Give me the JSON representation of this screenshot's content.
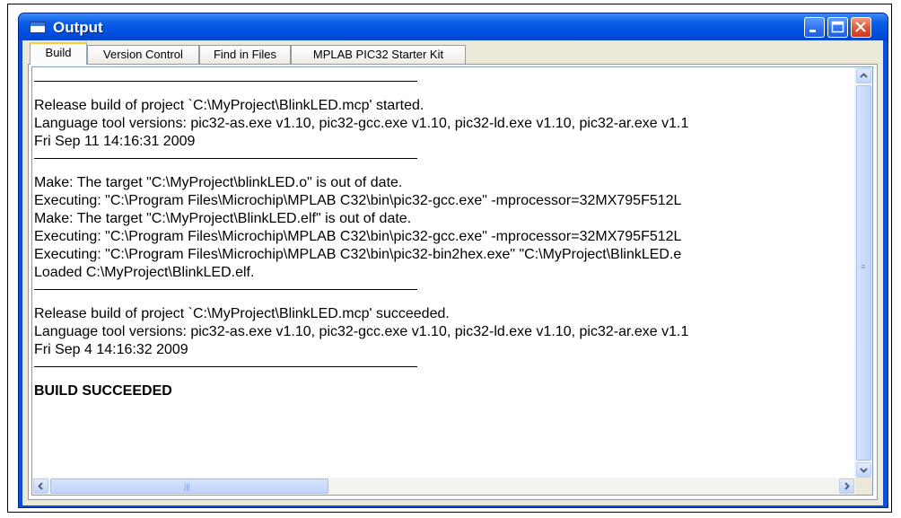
{
  "window": {
    "title": "Output",
    "accent": "#0a5de6",
    "close_color": "#e0563a"
  },
  "tabs": [
    {
      "label": "Build",
      "active": true
    },
    {
      "label": "Version Control",
      "active": false
    },
    {
      "label": "Find in Files",
      "active": false
    },
    {
      "label": "MPLAB PIC32 Starter Kit",
      "active": false
    }
  ],
  "output": {
    "lines": [
      "Release build of project `C:\\MyProject\\BlinkLED.mcp' started.",
      "Language tool versions: pic32-as.exe v1.10, pic32-gcc.exe v1.10, pic32-ld.exe v1.10, pic32-ar.exe v1.1",
      "Fri Sep 11 14:16:31 2009",
      "Make: The target \"C:\\MyProject\\blinkLED.o\" is out of date.",
      "Executing: \"C:\\Program Files\\Microchip\\MPLAB C32\\bin\\pic32-gcc.exe\" -mprocessor=32MX795F512L",
      "Make: The target \"C:\\MyProject\\BlinkLED.elf\" is out of date.",
      "Executing: \"C:\\Program Files\\Microchip\\MPLAB C32\\bin\\pic32-gcc.exe\" -mprocessor=32MX795F512L",
      "Executing: \"C:\\Program Files\\Microchip\\MPLAB C32\\bin\\pic32-bin2hex.exe\" \"C:\\MyProject\\BlinkLED.e",
      "Loaded C:\\MyProject\\BlinkLED.elf.",
      "Release build of project `C:\\MyProject\\BlinkLED.mcp' succeeded.",
      "Language tool versions: pic32-as.exe v1.10, pic32-gcc.exe v1.10, pic32-ld.exe v1.10, pic32-ar.exe v1.1",
      "Fri Sep  4 14:16:32 2009",
      "BUILD SUCCEEDED"
    ]
  },
  "icons": {
    "window": "window-icon",
    "minimize": "minimize-icon",
    "maximize": "maximize-icon",
    "close": "close-icon",
    "scroll_up": "chevron-up-icon",
    "scroll_down": "chevron-down-icon",
    "scroll_left": "chevron-left-icon",
    "scroll_right": "chevron-right-icon"
  }
}
